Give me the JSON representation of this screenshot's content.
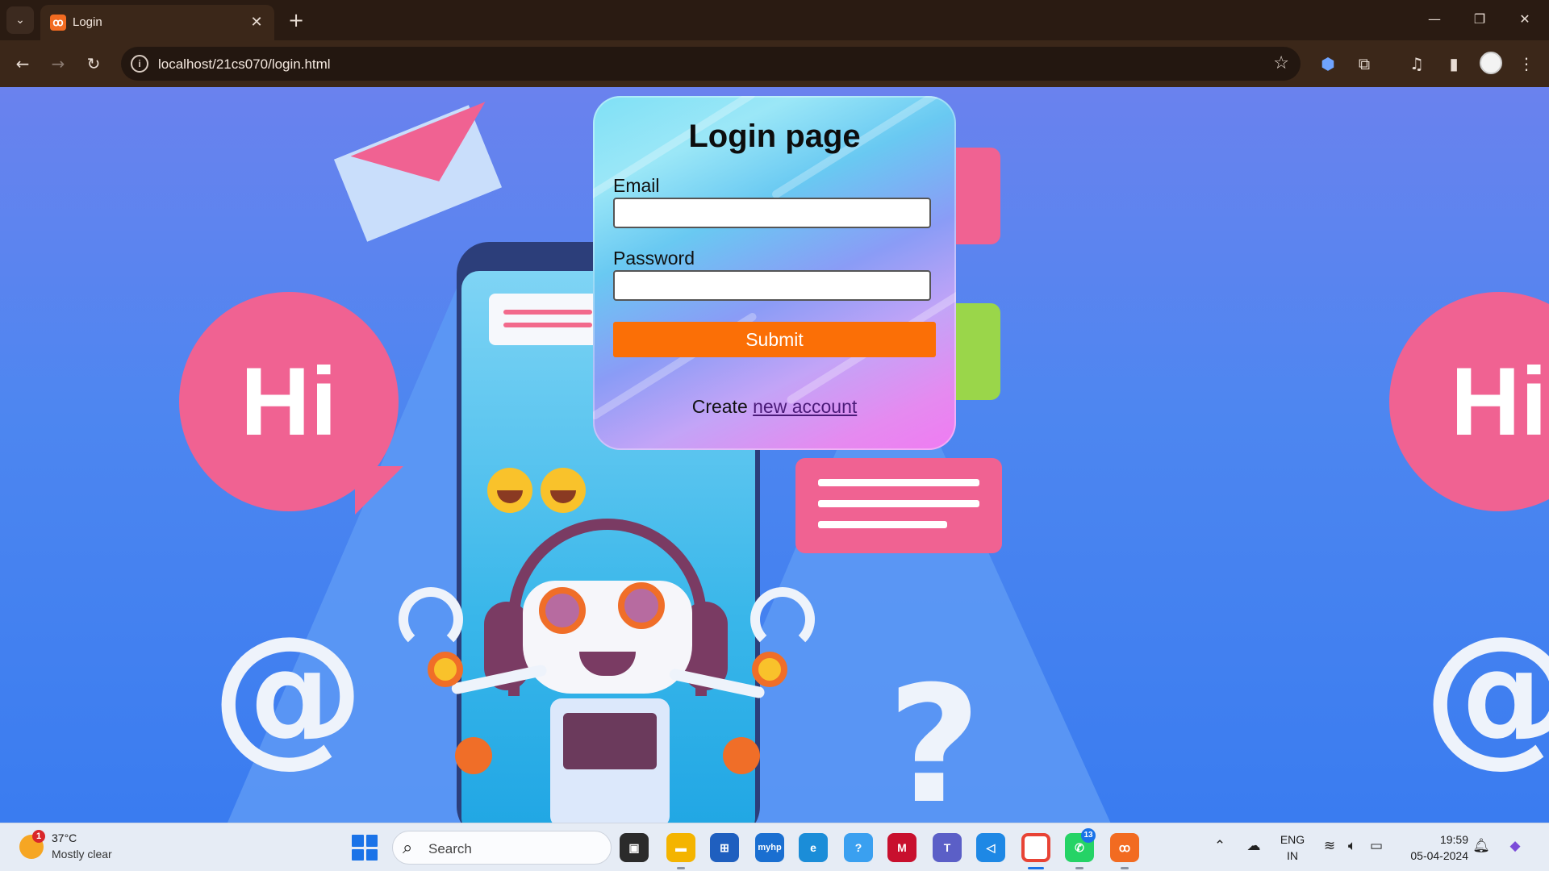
{
  "browser": {
    "tab_title": "Login",
    "tab_favicon": "xampp-icon",
    "url": "localhost/21cs070/login.html",
    "icons": [
      "tab-search-icon",
      "close-icon",
      "new-tab-icon",
      "minimize-icon",
      "restore-icon",
      "window-close-icon",
      "back-icon",
      "forward-icon",
      "reload-icon",
      "site-info-icon",
      "bookmark-star-icon",
      "extension-shield-icon",
      "extensions-puzzle-icon",
      "media-controls-icon",
      "side-panel-icon",
      "profile-avatar",
      "more-menu-icon"
    ]
  },
  "login": {
    "title": "Login page",
    "email_label": "Email",
    "email_value": "",
    "password_label": "Password",
    "password_value": "",
    "submit_label": "Submit",
    "create_prefix": "Create",
    "create_link": "new account",
    "accent_color": "#fb6f06"
  },
  "background": {
    "hi_text": "Hi",
    "at_symbol": "@",
    "question_symbol": "?",
    "primary_color": "#3a7cf0",
    "accent_pink": "#f06292"
  },
  "taskbar": {
    "weather_temp": "37°C",
    "weather_condition": "Mostly clear",
    "weather_badge": "1",
    "search_placeholder": "Search",
    "apps": [
      {
        "name": "task-view"
      },
      {
        "name": "file-explorer"
      },
      {
        "name": "microsoft-store"
      },
      {
        "name": "myhp",
        "label": "myhp"
      },
      {
        "name": "edge"
      },
      {
        "name": "copilot-app"
      },
      {
        "name": "mcafee"
      },
      {
        "name": "teams"
      },
      {
        "name": "vscode"
      },
      {
        "name": "chrome"
      },
      {
        "name": "whatsapp",
        "badge": "13"
      },
      {
        "name": "xampp"
      }
    ],
    "language_top": "ENG",
    "language_bottom": "IN",
    "time": "19:59",
    "date": "05-04-2024"
  }
}
